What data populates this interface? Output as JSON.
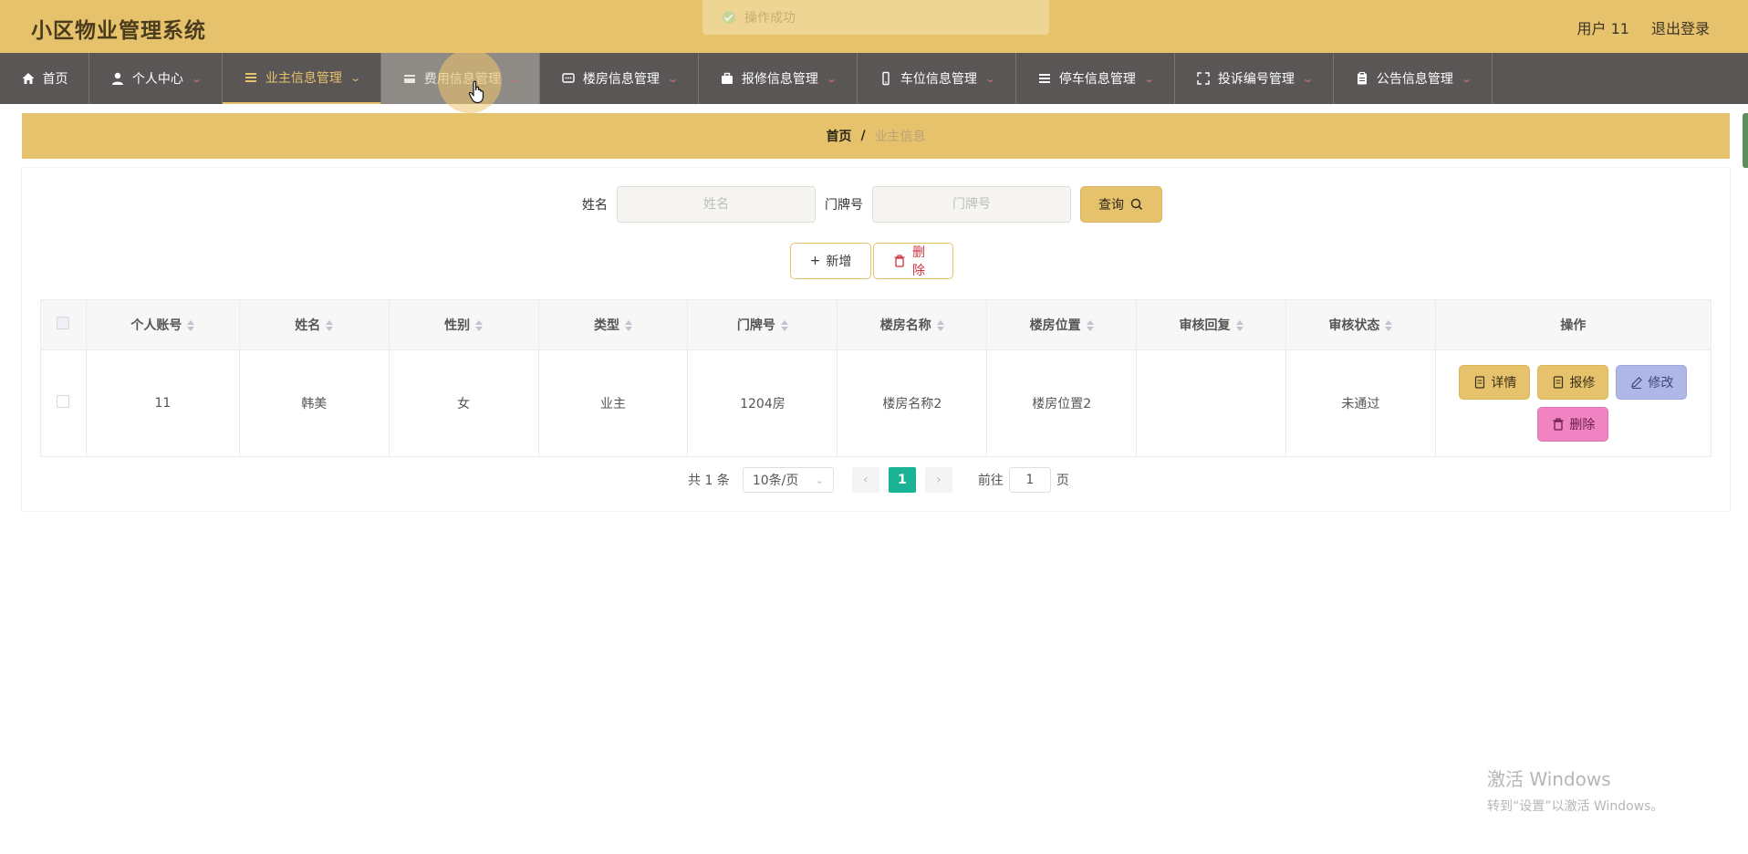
{
  "header": {
    "title": "小区物业管理系统",
    "user": "用户 11",
    "logout": "退出登录",
    "toast": "操作成功"
  },
  "nav": [
    {
      "label": "首页",
      "icon": "home-icon"
    },
    {
      "label": "个人中心",
      "icon": "user-icon"
    },
    {
      "label": "业主信息管理",
      "icon": "list-icon",
      "active": true
    },
    {
      "label": "费用信息管理",
      "icon": "money-icon",
      "hover": true
    },
    {
      "label": "楼房信息管理",
      "icon": "chat-icon"
    },
    {
      "label": "报修信息管理",
      "icon": "briefcase-icon"
    },
    {
      "label": "车位信息管理",
      "icon": "phone-icon"
    },
    {
      "label": "停车信息管理",
      "icon": "list-icon"
    },
    {
      "label": "投诉编号管理",
      "icon": "fullscreen-icon"
    },
    {
      "label": "公告信息管理",
      "icon": "clipboard-icon"
    }
  ],
  "breadcrumb": {
    "home": "首页",
    "separator": "/",
    "current": "业主信息"
  },
  "search": {
    "name_label": "姓名",
    "name_placeholder": "姓名",
    "name_value": "",
    "door_label": "门牌号",
    "door_placeholder": "门牌号",
    "door_value": "",
    "query_label": "查询"
  },
  "actions": {
    "add_label": "新增",
    "delete_label": "删除"
  },
  "table": {
    "columns": [
      "个人账号",
      "姓名",
      "性别",
      "类型",
      "门牌号",
      "楼房名称",
      "楼房位置",
      "审核回复",
      "审核状态",
      "操作"
    ],
    "rows": [
      {
        "account": "11",
        "name": "韩美",
        "gender": "女",
        "type": "业主",
        "door": "1204房",
        "building_name": "楼房名称2",
        "building_location": "楼房位置2",
        "review_reply": "",
        "review_status": "未通过"
      }
    ],
    "row_ops": {
      "detail": "详情",
      "repair": "报修",
      "edit": "修改",
      "delete": "删除"
    }
  },
  "pagination": {
    "total": "共 1 条",
    "page_size": "10条/页",
    "current_page": "1",
    "goto_label": "前往",
    "goto_value": "1",
    "page_unit": "页"
  },
  "watermark": {
    "title": "激活 Windows",
    "subtitle": "转到“设置”以激活 Windows。"
  },
  "colors": {
    "primary": "#e6c26c",
    "nav_bg": "#5a5656",
    "pager_active": "#1ab394",
    "edit_btn": "#aeb7e6",
    "delete_btn": "#f084c3"
  }
}
